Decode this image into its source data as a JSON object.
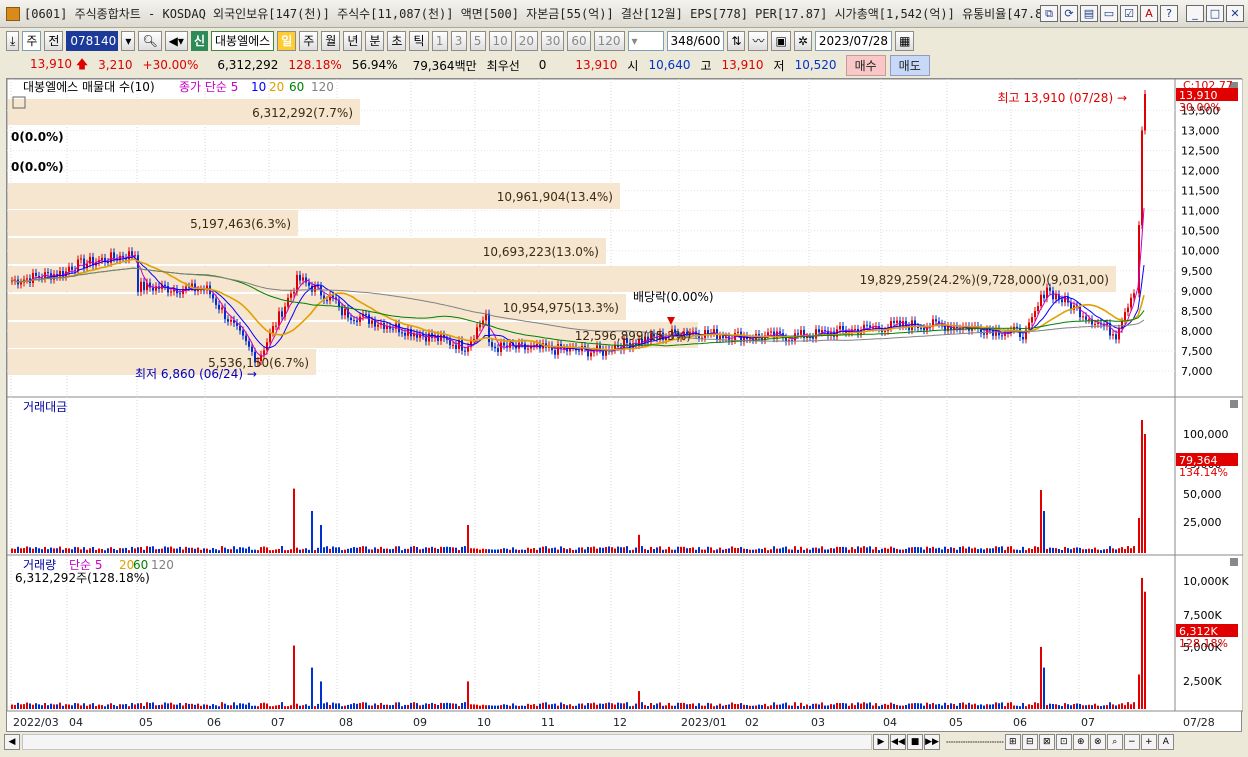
{
  "window": {
    "title": "[0601] 주식종합차트 - KOSDAQ 외국인보유[147(천)] 주식수[11,087(천)] 액면[500] 자본금[55(억)] 결산[12월] EPS[778] PER[17.87] 시가총액[1,542(억)] 유통비율[47.8]"
  },
  "toolbar": {
    "market": "주",
    "prev_label": "전",
    "code": "078140",
    "stock_name": "대봉엘에스",
    "sin_label": "신",
    "periods": [
      "일",
      "주",
      "월",
      "년",
      "분",
      "초",
      "틱"
    ],
    "active_period": "일",
    "intervals": [
      "1",
      "3",
      "5",
      "10",
      "20",
      "30",
      "60",
      "120"
    ],
    "count": "348",
    "count_max": "/600",
    "date": "2023/07/28"
  },
  "quote": {
    "price": "13,910",
    "change": "3,210",
    "change_pct": "+30.00%",
    "volume": "6,312,292",
    "volume_ratio": "128.18%",
    "rate": "56.94%",
    "amount": "79,364백만",
    "priority_label": "최우선",
    "priority_value": "0",
    "last": "13,910",
    "open_label": "시",
    "open": "10,640",
    "high_label": "고",
    "high": "13,910",
    "low_label": "저",
    "low": "10,520",
    "buy": "매수",
    "sell": "매도"
  },
  "price_panel": {
    "title": "대봉엘에스 매물대 수(10)",
    "ma_title": "종가 단순",
    "ma_periods": [
      "5",
      "10",
      "20",
      "60",
      "120"
    ],
    "top_right_label": "C:102.77",
    "last_price_tag": "13,910",
    "last_pct_tag": "30.00%",
    "high_annotation": "최고 13,910 (07/28)",
    "low_annotation": "최저 6,860 (06/24)",
    "dividend_annotation": "배당락(0.00%)",
    "left_labels": [
      "0(0.0%)",
      "0(0.0%)"
    ],
    "y_ticks": [
      "13,500",
      "13,000",
      "12,500",
      "12,000",
      "11,500",
      "11,000",
      "10,500",
      "10,000",
      "9,500",
      "9,000",
      "8,500",
      "8,000",
      "7,500",
      "7,000"
    ],
    "volume_profile": [
      {
        "label": "6,312,292(7.7%)"
      },
      {
        "label": "10,961,904(13.4%)"
      },
      {
        "label": "5,197,463(6.3%)"
      },
      {
        "label": "10,693,223(13.0%)"
      },
      {
        "label": "19,829,259(24.2%)(9,728,000)(9,031,00)"
      },
      {
        "label": "10,954,975(13.3%)"
      },
      {
        "label": "12,596,899(15.3%)"
      },
      {
        "label": "5,536,150(6.7%)"
      }
    ]
  },
  "amount_panel": {
    "title": "거래대금",
    "y_ticks": [
      "100,000",
      "75,000",
      "50,000",
      "25,000"
    ],
    "last_tag": "79,364",
    "last_pct": "134.14%"
  },
  "volume_panel": {
    "title": "거래량",
    "ma_title": "단순",
    "ma_periods": [
      "5",
      "20",
      "60",
      "120"
    ],
    "sub_label": "6,312,292주(128.18%)",
    "y_ticks": [
      "10,000K",
      "7,500K",
      "5,000K",
      "2,500K"
    ],
    "last_tag": "6,312K",
    "last_pct": "128.18%"
  },
  "x_axis": {
    "labels": [
      "2022/03",
      "04",
      "05",
      "06",
      "07",
      "08",
      "09",
      "10",
      "11",
      "12",
      "2023/01",
      "02",
      "03",
      "04",
      "05",
      "06",
      "07"
    ],
    "right_label": "07/28"
  },
  "colors": {
    "up": "#e00000",
    "down": "#0030d0",
    "ma5": "#c800c8",
    "ma10": "#0000ff",
    "ma20": "#e0a000",
    "ma60": "#008000",
    "ma120": "#808080",
    "profile": "#f7e6cf"
  },
  "bottom_controls": {
    "zoom_out": "−",
    "zoom_in": "+",
    "auto": "A"
  }
}
